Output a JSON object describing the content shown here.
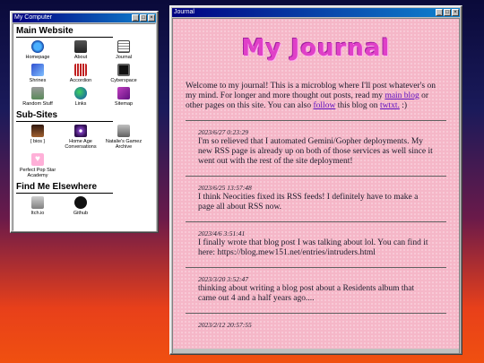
{
  "computer": {
    "title": "My Computer",
    "sections": [
      {
        "heading": "Main Website",
        "items": [
          {
            "label": "Homepage",
            "icon": "ie-icon"
          },
          {
            "label": "About",
            "icon": "speaker-icon"
          },
          {
            "label": "Journal",
            "icon": "notepad-icon"
          },
          {
            "label": "Shrines",
            "icon": "shrine-icon"
          },
          {
            "label": "Accordion",
            "icon": "accordion-icon"
          },
          {
            "label": "Cyberspace",
            "icon": "monitor-icon"
          },
          {
            "label": "Random Stuff",
            "icon": "trash-icon"
          },
          {
            "label": "Links",
            "icon": "globe-icon"
          },
          {
            "label": "Sitemap",
            "icon": "book-icon"
          }
        ]
      },
      {
        "heading": "Sub-Sites",
        "items": [
          {
            "label": "{ bios }",
            "icon": "bios-icon"
          },
          {
            "label": "Home Age Conversations",
            "icon": "cd-icon"
          },
          {
            "label": "Natalie's Gamez Archive",
            "icon": "joystick-icon"
          },
          {
            "label": "Perfect Pop Star Academy",
            "icon": "heart-icon"
          }
        ]
      },
      {
        "heading": "Find Me Elsewhere",
        "items": [
          {
            "label": "Itch.io",
            "icon": "gamepad-icon"
          },
          {
            "label": "Github",
            "icon": "github-icon"
          }
        ]
      }
    ]
  },
  "journal": {
    "title": "Journal",
    "heading": "My Journal",
    "intro_1": "Welcome to my journal! This is a microblog where I'll post whatever's on my mind. For longer and more thought out posts, read my ",
    "link_main_blog": "main blog",
    "intro_2": " or other pages on this site. You can also ",
    "link_follow": "follow",
    "intro_3": " this blog on ",
    "link_twtxt": "twtxt.",
    "intro_4": " :)",
    "posts": [
      {
        "date": "2023/6/27 0:23:29",
        "text": "I'm so relieved that I automated Gemini/Gopher deployments. My new RSS page is already up on both of those services as well since it went out with the rest of the site deployment!"
      },
      {
        "date": "2023/6/25 13:57:48",
        "text": "I think Neocities fixed its RSS feeds! I definitely have to make a page all about RSS now."
      },
      {
        "date": "2023/4/6 3:51:41",
        "text": "I finally wrote that blog post I was talking about lol. You can find it here: https://blog.mew151.net/entries/intruders.html"
      },
      {
        "date": "2023/3/20 3:52:47",
        "text": "thinking about writing a blog post about a Residents album that came out 4 and a half years ago...."
      },
      {
        "date": "2023/2/12 20:57:55",
        "text": ""
      }
    ]
  },
  "colors": {
    "title_bar": "#000080",
    "journal_bg": "#f5b7c8",
    "journal_heading": "#e040c8",
    "link": "#6010c0"
  }
}
